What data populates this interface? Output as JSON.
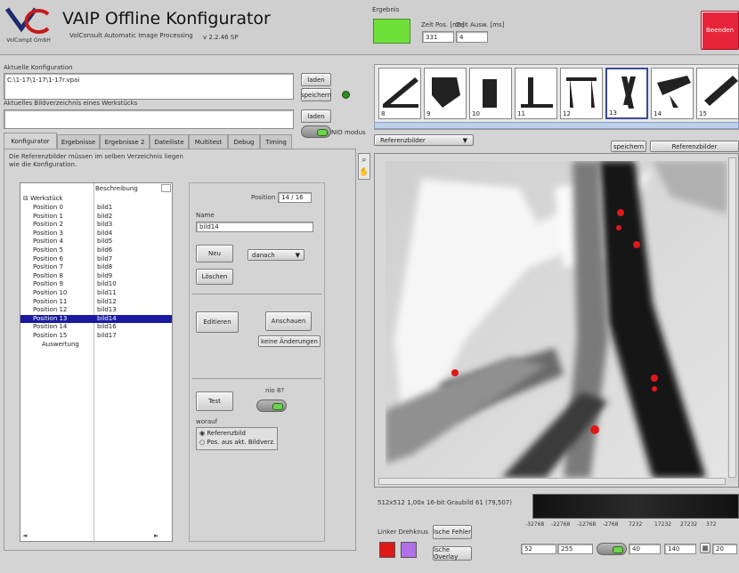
{
  "header": {
    "company": "VolCompt GmbH",
    "title": "VAIP Offline Konfigurator",
    "subtitle": "VolConsult Automatic Image Processing",
    "version": "v 2.2.46 SP",
    "ergebnis_label": "Ergebnis",
    "result_color": "#6fe03a",
    "zeit_pos_label": "Zeit Pos. [ms]",
    "zeit_pos_value": "331",
    "zeit_ausw_label": "Zeit Ausw. [ms]",
    "zeit_ausw_value": "4",
    "beenden_label": "Beenden",
    "beenden_color": "#e8243a"
  },
  "config": {
    "label": "Aktuelle Konfiguration",
    "path": "C:\\1-17\\1-17\\1-17r.vpai",
    "laden": "laden",
    "speichern": "speichern"
  },
  "imgdir": {
    "label": "Aktuelles Bildverzeichnis eines Werkstücks",
    "path": "",
    "laden": "laden",
    "nio_label": "NIO modus"
  },
  "tabs": [
    "Konfigurator",
    "Ergebnisse",
    "Ergebnisse 2",
    "Dateiliste",
    "Multitest",
    "Debug",
    "Timing"
  ],
  "info_text": "Die Referenzbilder müssen im selben Verzeichnis liegen wie die Konfiguration.",
  "tree": {
    "col_beschreibung": "Beschreibung",
    "root": "Werkstück",
    "items": [
      {
        "pos": "Position 0",
        "bild": "bild1"
      },
      {
        "pos": "Position 1",
        "bild": "bild2"
      },
      {
        "pos": "Position 2",
        "bild": "bild3"
      },
      {
        "pos": "Position 3",
        "bild": "bild4"
      },
      {
        "pos": "Position 4",
        "bild": "bild5"
      },
      {
        "pos": "Position 5",
        "bild": "bild6"
      },
      {
        "pos": "Position 6",
        "bild": "bild7"
      },
      {
        "pos": "Position 7",
        "bild": "bild8"
      },
      {
        "pos": "Position 8",
        "bild": "bild9"
      },
      {
        "pos": "Position 9",
        "bild": "bild10"
      },
      {
        "pos": "Position 10",
        "bild": "bild11"
      },
      {
        "pos": "Position 11",
        "bild": "bild12"
      },
      {
        "pos": "Position 12",
        "bild": "bild13"
      },
      {
        "pos": "Position 13",
        "bild": "bild14"
      },
      {
        "pos": "Position 14",
        "bild": "bild16"
      },
      {
        "pos": "Position 15",
        "bild": "bild17"
      }
    ],
    "last": "Auswertung",
    "selected_index": 13
  },
  "editor": {
    "position_label": "Position",
    "position_value": "14 / 16",
    "name_label": "Name",
    "name_value": "bild14",
    "neu": "Neu",
    "danach": "danach",
    "loeschen": "Löschen",
    "editieren": "Editieren",
    "anschauen": "Anschauen",
    "keine_aenderungen": "keine Änderungen",
    "test": "Test",
    "nio_label": "nio 8?",
    "worauf": "worauf",
    "radio1": "Referenzbild",
    "radio2": "Pos. aus akt. Bildverz."
  },
  "thumbs": [
    "8",
    "9",
    "10",
    "11",
    "12",
    "13",
    "14",
    "15"
  ],
  "thumb_selected": 5,
  "viewer": {
    "ref_select": "Referenzbilder",
    "speichern": "speichern",
    "ref_label": "Referenzbilder",
    "status": "512x512 1,00x 16-bit Graubild 61 (79,507)",
    "histo_ticks": [
      "-32768",
      "-22768",
      "-12768",
      "-2768",
      "7232",
      "17232",
      "27232",
      "372"
    ],
    "farbe_label": "Linker Drehknus",
    "col_red": "#e01818",
    "col_purple": "#b070e8",
    "btn_fehler": "lsche Fehler",
    "btn_overlay": "lsche Overlay",
    "v1": "52",
    "v2": "255",
    "v3": "40",
    "v4": "140",
    "v5": "20"
  }
}
